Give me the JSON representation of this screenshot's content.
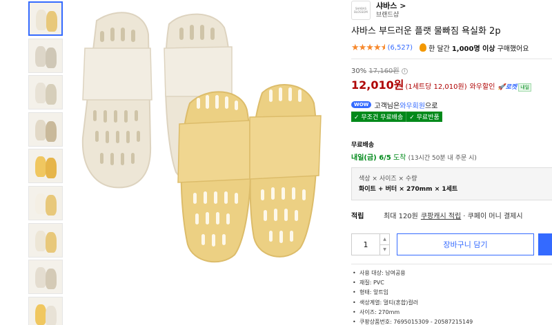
{
  "brand": {
    "logo_text": "SHABAS\nBLOSSOM",
    "name": "샤바스 >",
    "sub": "브랜드샵"
  },
  "product": {
    "title": "샤바스 부드러운 플랫 물빠짐 욕실화 2p",
    "rating_stars": 4.5,
    "review_count": "(6,527)",
    "sold_prefix": "한 달간",
    "sold_count": "1,000명 이상",
    "sold_suffix": "구매했어요"
  },
  "price": {
    "discount_rate": "30%",
    "original": "17,160원",
    "info_icon": "i",
    "sale": "12,010원",
    "unit": "(1세트당 12,010원)",
    "wow_label": "와우할인",
    "rocket_label": "로켓",
    "rocket_badge": "내일"
  },
  "wow": {
    "badge": "WOW",
    "prefix": "고객님은 ",
    "member": "와우회원",
    "suffix": "으로"
  },
  "badges": [
    "✓ 무조건 무료배송",
    "✓ 무료반품"
  ],
  "shipping": {
    "title": "무료배송",
    "date": "내일(금) 6/5",
    "arrival": "도착",
    "deadline": "(13시간 50분 내 주문 시)"
  },
  "option": {
    "label": "색상 × 사이즈 × 수량",
    "value": "화이트 + 버터 × 270mm × 1세트"
  },
  "points": {
    "label": "적립",
    "prefix": "최대 120원",
    "link": "쿠팡캐시 적립",
    "suffix": "· 쿠페이 머니 결제시"
  },
  "cart": {
    "quantity": "1",
    "add_to_cart": "장바구니 담기"
  },
  "specs": [
    "사용 대상: 남여공용",
    "재질: PVC",
    "형태: 앞트임",
    "색상계열: 멀티(혼합)컬러",
    "사이즈: 270mm",
    "쿠팡상품번호: 7695015309 - 20587215149"
  ],
  "thumbnails": [
    {
      "colors": [
        "#ede6d6",
        "#e8c87a"
      ],
      "active": true
    },
    {
      "colors": [
        "#ddd6c8",
        "#cfc7b6"
      ],
      "active": false
    },
    {
      "colors": [
        "#e8e2d6",
        "#d6ceba"
      ],
      "active": false
    },
    {
      "colors": [
        "#e2d9c7",
        "#c9b99a"
      ],
      "active": false
    },
    {
      "colors": [
        "#f0c760",
        "#e6b54a"
      ],
      "active": false
    },
    {
      "colors": [
        "#f4efe4",
        "#e8c87a"
      ],
      "active": false
    },
    {
      "colors": [
        "#ede6d6",
        "#e8c87a"
      ],
      "active": false
    },
    {
      "colors": [
        "#e4ddd0",
        "#d4cab6"
      ],
      "active": false
    },
    {
      "colors": [
        "#f0c760",
        "#e8e2d6"
      ],
      "active": false
    }
  ],
  "colors": {
    "accent": "#346aff",
    "price_red": "#ae0000",
    "green": "#00891a",
    "star": "#f7892d",
    "white_slipper": "#ede6d6",
    "butter_slipper": "#ecd083"
  }
}
